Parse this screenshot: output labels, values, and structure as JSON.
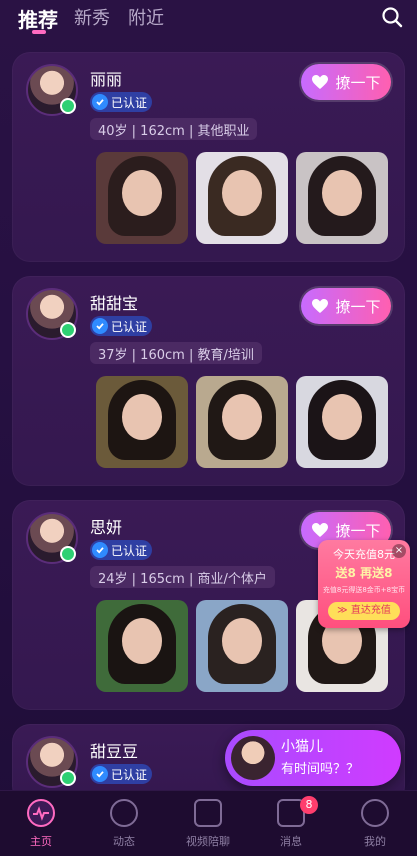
{
  "tabs": [
    {
      "label": "推荐"
    },
    {
      "label": "新秀"
    },
    {
      "label": "附近"
    }
  ],
  "users": [
    {
      "name": "丽丽",
      "verified_label": "已认证",
      "tags": "40岁 | 162cm | 其他职业",
      "flirt_label": "撩一下"
    },
    {
      "name": "甜甜宝",
      "verified_label": "已认证",
      "tags": "37岁 | 160cm | 教育/培训",
      "flirt_label": "撩一下"
    },
    {
      "name": "思妍",
      "verified_label": "已认证",
      "tags": "24岁 | 165cm | 商业/个体户",
      "flirt_label": "撩一下"
    },
    {
      "name": "甜豆豆",
      "verified_label": "已认证"
    }
  ],
  "promo": {
    "line1": "今天充值8元",
    "line2": "送8 再送8",
    "line3": "充值8元得送8金币+8宝币",
    "cta": "≫ 直达充值"
  },
  "chat_popup": {
    "name": "小猫儿",
    "message": "有时间吗？？"
  },
  "nav": [
    {
      "label": "主页"
    },
    {
      "label": "动态"
    },
    {
      "label": "视频陪聊"
    },
    {
      "label": "消息"
    },
    {
      "label": "我的"
    }
  ],
  "badge_count": "8"
}
